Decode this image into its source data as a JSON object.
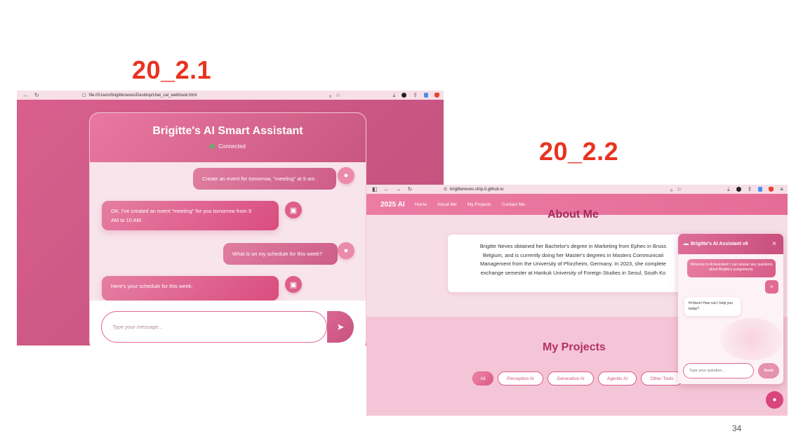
{
  "slide": {
    "title_left": "20_2.1",
    "title_right": "20_2.2",
    "page_number": "34"
  },
  "shot1": {
    "browser": {
      "url": "file:///Users/brigitteneves/Desktop/chat_cal_webhook.html"
    },
    "chat": {
      "title": "Brigitte's AI Smart Assistant",
      "status": "Connected",
      "messages": [
        {
          "role": "user",
          "text": "Create an event for tomorrow, \"meeting\" at 9 am ."
        },
        {
          "role": "bot",
          "line1": "OK. I've created an event \"meeting\" for you tomorrow from 9",
          "line2": "AM to 10 AM."
        },
        {
          "role": "user",
          "text": "What is on my schedule for this week?"
        },
        {
          "role": "bot",
          "text": "Here's your schedule for this week:"
        }
      ],
      "input_placeholder": "Type your message..."
    }
  },
  "shot2": {
    "browser": {
      "url": "brigitteneves-ship-it.github.io"
    },
    "nav": {
      "brand": "2025 AI",
      "links": [
        "Home",
        "About Me",
        "My Projects",
        "Contact Me"
      ]
    },
    "about": {
      "heading": "About Me",
      "lines": [
        "Brigitte Neves obtained her Bachelor's degree in Marketing from Ephec in Bruss",
        "Belgium, and is currently doing her Master's degrees in Masters Communicati",
        "Management from the University of Pforzheim, Germany. In 2023, she complete",
        "exchange semester at Hankuk University of Foreign Studies in Seoul, South Ko"
      ]
    },
    "projects": {
      "title": "My Projects",
      "filters": [
        "All",
        "Perception AI",
        "Generative AI",
        "Agentic AI",
        "Other Tools"
      ]
    },
    "assistant": {
      "title": "Brigitte's AI Assistant v6",
      "close": "×",
      "welcome": "Welcome to AI Assistant! I can answer any questions about Brigitte's assignments.",
      "user_msg": "hi",
      "bot_msg": "Hi there! How can I help you today?",
      "input_placeholder": "Type your question...",
      "send_label": "Send"
    }
  }
}
